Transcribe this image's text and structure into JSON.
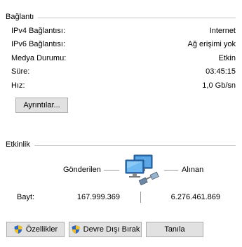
{
  "connection": {
    "section_title": "Bağlantı",
    "rows": [
      {
        "key": "IPv4 Bağlantısı:",
        "value": "Internet"
      },
      {
        "key": "IPv6 Bağlantısı:",
        "value": "Ağ erişimi yok"
      },
      {
        "key": "Medya Durumu:",
        "value": "Etkin"
      },
      {
        "key": "Süre:",
        "value": "03:45:15"
      },
      {
        "key": "Hız:",
        "value": "1,0 Gb/sn"
      }
    ],
    "details_button_label": "Ayrıntılar..."
  },
  "activity": {
    "section_title": "Etkinlik",
    "sent_label": "Gönderilen",
    "received_label": "Alınan",
    "bytes_label": "Bayt:",
    "bytes_sent": "167.999.369",
    "bytes_received": "6.276.461.869"
  },
  "buttons": {
    "properties_label": "Özellikler",
    "disable_label": "Devre Dışı Bırak",
    "diagnose_label": "Tanıla"
  },
  "icons": {
    "network": "network-computers-icon",
    "shield": "uac-shield-icon"
  }
}
